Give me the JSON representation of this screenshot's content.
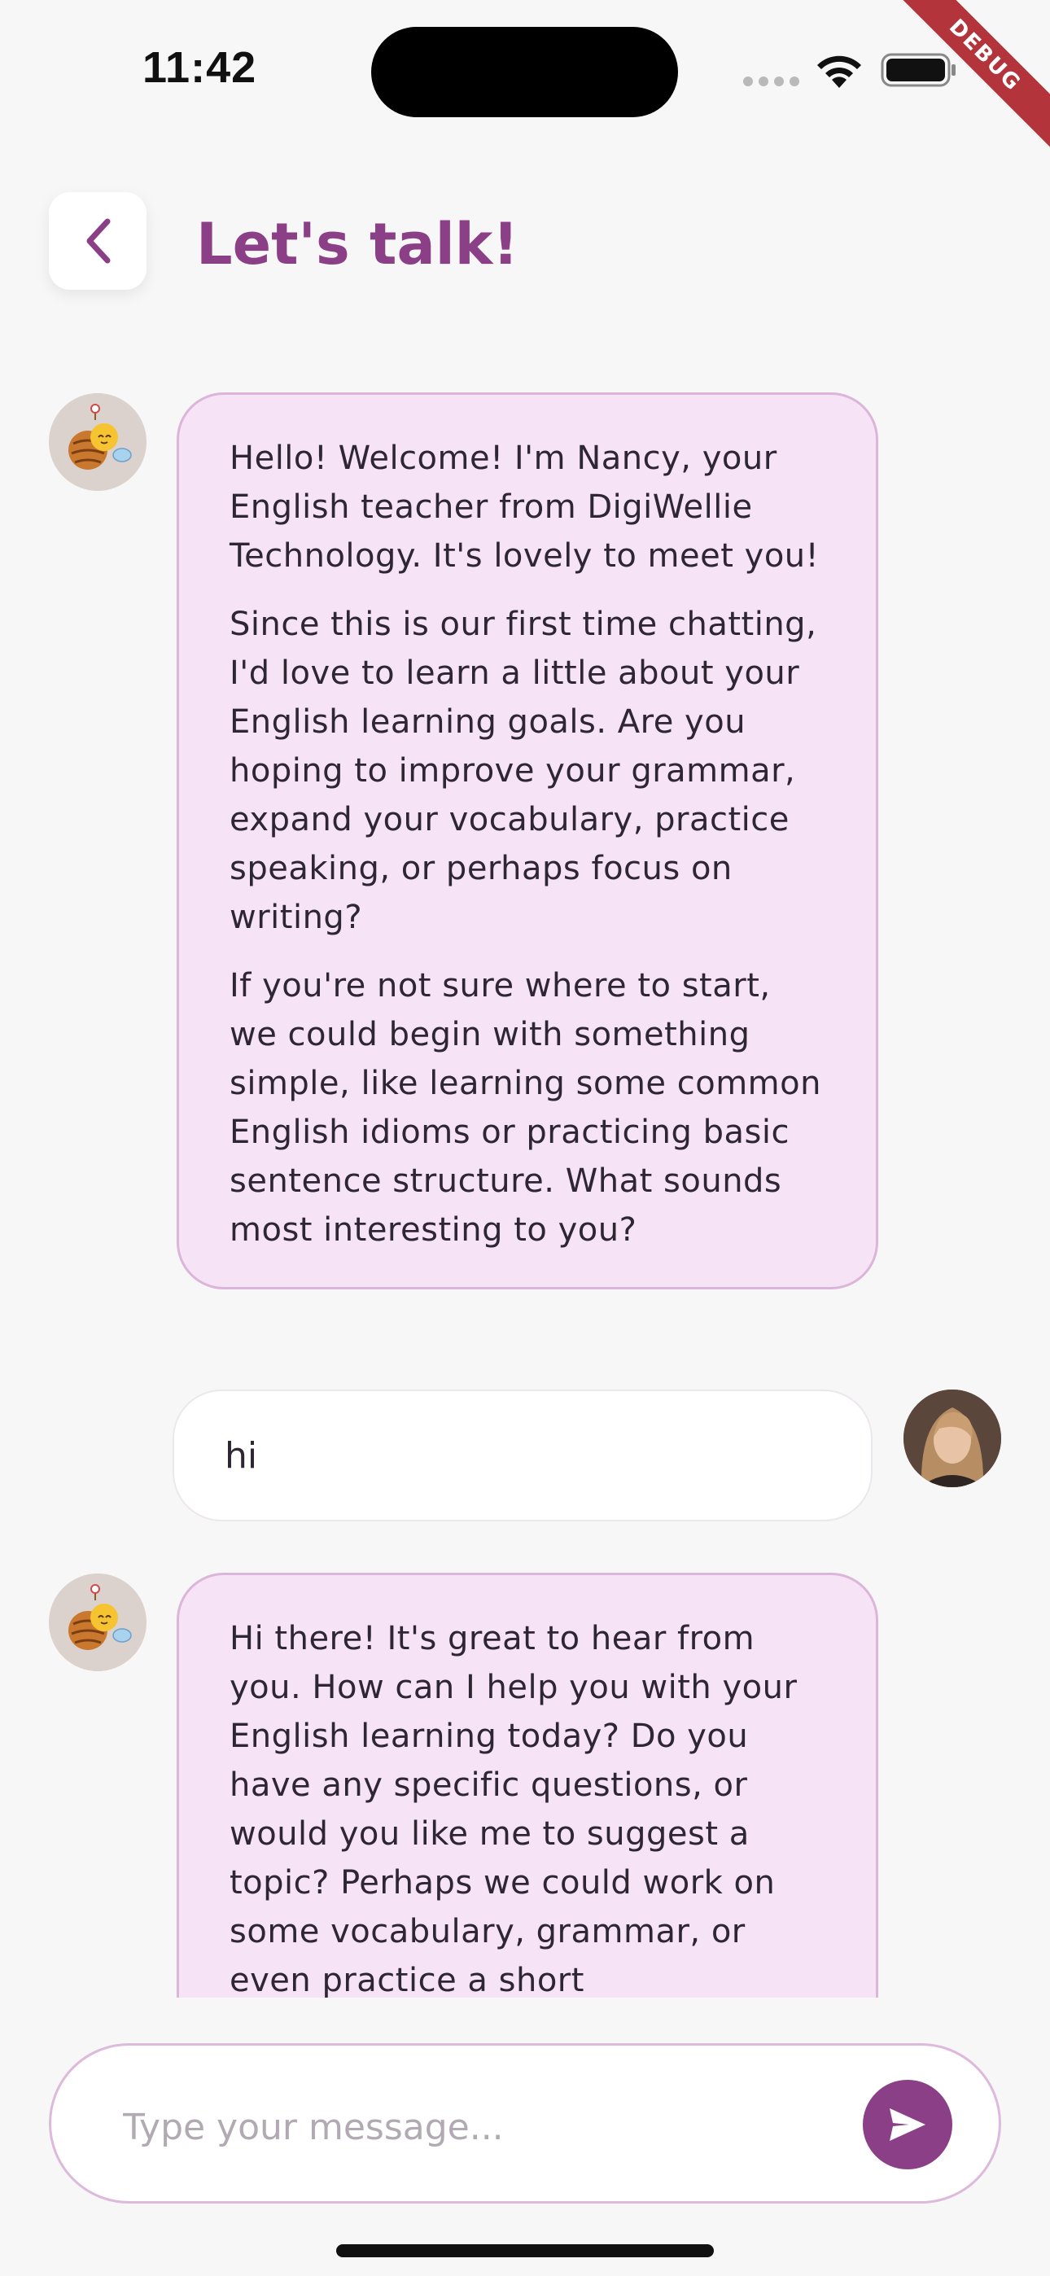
{
  "status_bar": {
    "time": "11:42",
    "icons": [
      "signal-icon",
      "wifi-icon",
      "battery-icon"
    ]
  },
  "debug_banner": "DEBUG",
  "header": {
    "back_icon": "chevron-left-icon",
    "title": "Let's talk!"
  },
  "messages": [
    {
      "sender": "bot",
      "avatar": "bee-mascot",
      "paragraphs": [
        "Hello! Welcome! I'm Nancy, your English teacher from DigiWellie Technology. It's lovely to meet you!",
        "Since this is our first time chatting, I'd love to learn a little about your English learning goals. Are you hoping to improve your grammar, expand your vocabulary, practice speaking, or perhaps focus on writing?",
        "If you're not sure where to start, we could begin with something simple, like learning some common English idioms or practicing basic sentence structure. What sounds most interesting to you?"
      ]
    },
    {
      "sender": "user",
      "avatar": "user-photo",
      "text": "hi"
    },
    {
      "sender": "bot",
      "avatar": "bee-mascot",
      "paragraphs": [
        "Hi there! It's great to hear from you. How can I help you with your English learning today? Do you have any specific questions, or would you like me to suggest a topic? Perhaps we could work on some vocabulary, grammar, or even practice a short conversation?"
      ]
    }
  ],
  "composer": {
    "placeholder": "Type your message...",
    "value": "",
    "send_icon": "send-icon"
  },
  "colors": {
    "accent": "#8b3f86",
    "bot_bubble": "#f6e3f6",
    "bot_bubble_border": "#dcb5da",
    "background": "#f8f7f8"
  }
}
